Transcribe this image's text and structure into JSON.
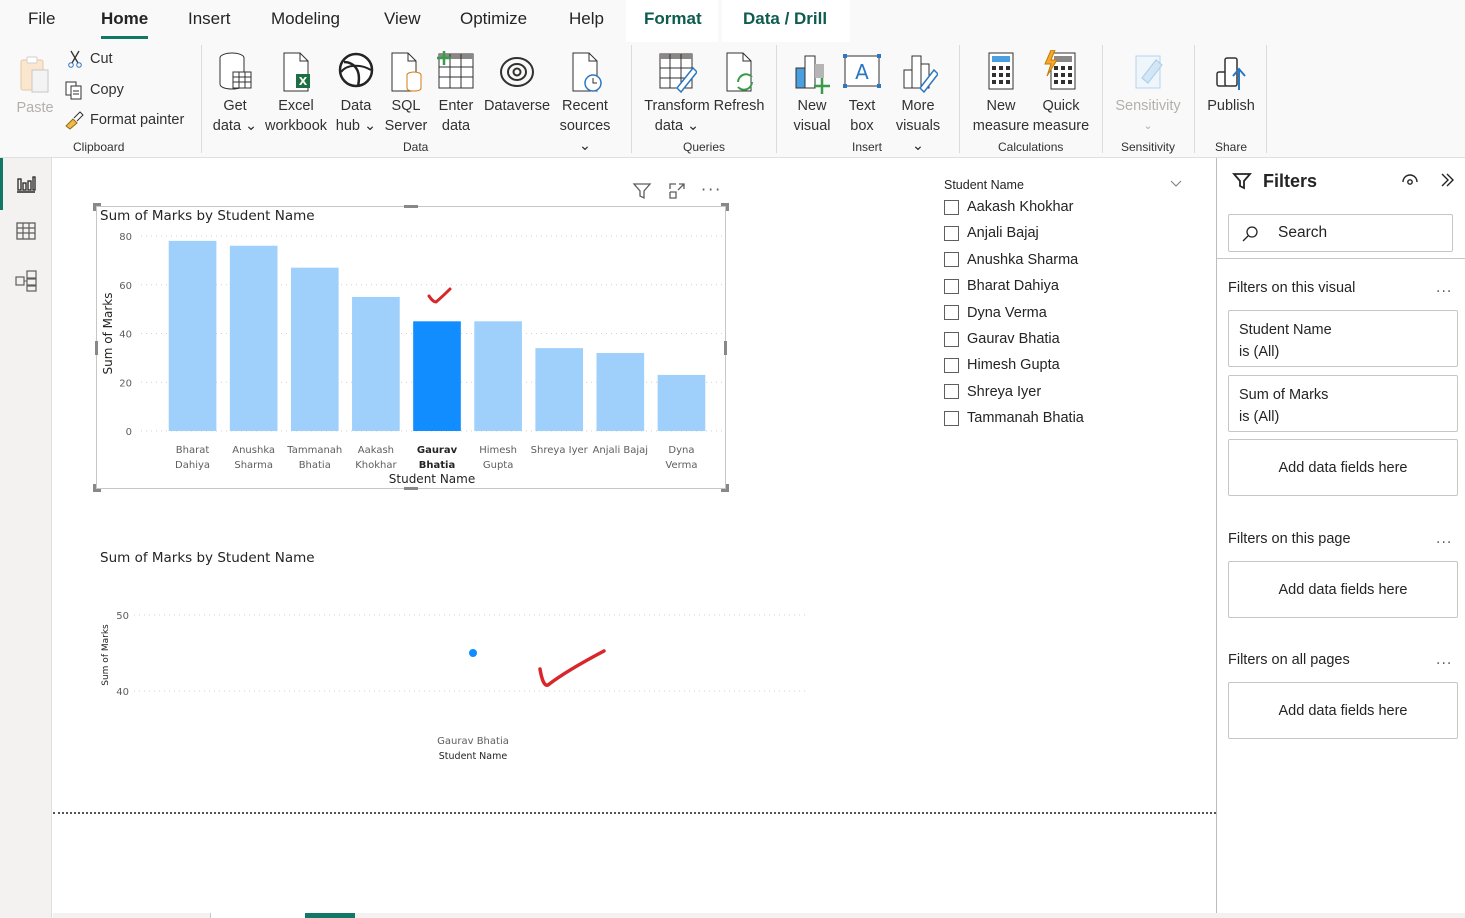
{
  "ribbon_tabs": [
    "File",
    "Home",
    "Insert",
    "Modeling",
    "View",
    "Optimize",
    "Help",
    "Format",
    "Data / Drill"
  ],
  "active_tab": "Home",
  "ribbon": {
    "clipboard": {
      "paste": "Paste",
      "cut": "Cut",
      "copy": "Copy",
      "format_painter": "Format painter",
      "group": "Clipboard"
    },
    "data": {
      "get_data": [
        "Get",
        "data"
      ],
      "excel": [
        "Excel",
        "workbook"
      ],
      "data_hub": [
        "Data",
        "hub"
      ],
      "sql": [
        "SQL",
        "Server"
      ],
      "enter_data": [
        "Enter",
        "data"
      ],
      "dataverse": "Dataverse",
      "recent": [
        "Recent",
        "sources"
      ],
      "group": "Data"
    },
    "queries": {
      "transform": [
        "Transform",
        "data"
      ],
      "refresh": "Refresh",
      "group": "Queries"
    },
    "insert": {
      "new_visual": [
        "New",
        "visual"
      ],
      "text_box": [
        "Text",
        "box"
      ],
      "more_visuals": [
        "More",
        "visuals"
      ],
      "group": "Insert"
    },
    "calculations": {
      "new_measure": [
        "New",
        "measure"
      ],
      "quick_measure": [
        "Quick",
        "measure"
      ],
      "group": "Calculations"
    },
    "sensitivity": {
      "label": "Sensitivity",
      "group": "Sensitivity"
    },
    "share": {
      "publish": "Publish",
      "group": "Share"
    }
  },
  "colors": {
    "accent": "#117865",
    "bar": "#9fd0fb",
    "bar_selected": "#118dff",
    "annotation": "#d9262a"
  },
  "visual_header_icons": [
    "filter-icon",
    "focus-mode-icon",
    "more-options-icon"
  ],
  "chart_data": [
    {
      "type": "bar",
      "title": "Sum of Marks by Student Name",
      "xlabel": "Student Name",
      "ylabel": "Sum of Marks",
      "categories": [
        "Bharat Dahiya",
        "Anushka Sharma",
        "Tammanah Bhatia",
        "Aakash Khokhar",
        "Gaurav Bhatia",
        "Himesh Gupta",
        "Shreya Iyer",
        "Anjali Bajaj",
        "Dyna Verma"
      ],
      "category_lines": [
        [
          "Bharat",
          "Dahiya"
        ],
        [
          "Anushka",
          "Sharma"
        ],
        [
          "Tammanah",
          "Bhatia"
        ],
        [
          "Aakash",
          "Khokhar"
        ],
        [
          "Gaurav",
          "Bhatia"
        ],
        [
          "Himesh",
          "Gupta"
        ],
        [
          "Shreya Iyer"
        ],
        [
          "Anjali Bajaj"
        ],
        [
          "Dyna",
          "Verma"
        ]
      ],
      "values": [
        78,
        76,
        67,
        55,
        45,
        45,
        34,
        32,
        23
      ],
      "selected": "Gaurav Bhatia",
      "yticks": [
        0,
        20,
        40,
        60,
        80
      ],
      "ylim": [
        0,
        80
      ],
      "grid": true
    },
    {
      "type": "scatter",
      "title": "Sum of Marks by Student Name",
      "xlabel": "Student Name",
      "ylabel": "Sum of Marks",
      "categories": [
        "Gaurav Bhatia"
      ],
      "values": [
        45
      ],
      "yticks": [
        40,
        50
      ],
      "ylim": [
        40,
        50
      ],
      "grid": true
    }
  ],
  "slicer": {
    "title": "Student Name",
    "items": [
      "Aakash Khokhar",
      "Anjali Bajaj",
      "Anushka Sharma",
      "Bharat Dahiya",
      "Dyna Verma",
      "Gaurav Bhatia",
      "Himesh Gupta",
      "Shreya Iyer",
      "Tammanah Bhatia"
    ]
  },
  "filters": {
    "title": "Filters",
    "search_placeholder": "Search",
    "on_visual": {
      "label": "Filters on this visual",
      "cards": [
        {
          "field": "Student Name",
          "state": "is (All)"
        },
        {
          "field": "Sum of Marks",
          "state": "is (All)"
        }
      ],
      "add": "Add data fields here"
    },
    "on_page": {
      "label": "Filters on this page",
      "add": "Add data fields here"
    },
    "on_all": {
      "label": "Filters on all pages",
      "add": "Add data fields here"
    },
    "more": "..."
  }
}
